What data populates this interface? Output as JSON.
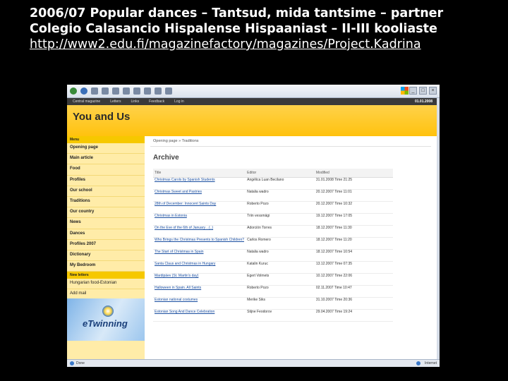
{
  "slide": {
    "title_line1": "2006/07 Popular dances – Tantsud, mida tantsime – partner",
    "title_line2": "Colegio Calasancio Hispalense Hispaaniast – II-III kooliaste",
    "link": "http://www2.edu.fi/magazinefactory/magazines/Project.Kadrina"
  },
  "site": {
    "nav": [
      "Central magazine",
      "Letters",
      "Links",
      "Feedback",
      "Log in"
    ],
    "date": "01.01.2008",
    "brand": "You and Us",
    "breadcrumb": "Opening page » Traditions",
    "heading": "Archive",
    "sidebar_head": "Menu",
    "sidebar_items": [
      "Opening page",
      "Main article",
      "Food",
      "Profiles",
      "Our school",
      "Traditions",
      "Our country",
      "News",
      "Dances",
      "Profiles 2007",
      "Dictionary",
      "My Bedroom"
    ],
    "sidebar_head2": "New letters",
    "sidebar_items2": [
      "Hungarian food-Estonian",
      "Add mail"
    ],
    "etwinning": "eTwinning",
    "columns": [
      "Title",
      "Editor",
      "Modified"
    ],
    "rows": [
      {
        "title": "Christmas Carols by Spanish Students",
        "editor": "Angélica Luan Becilano",
        "modified": "31.01.2008 Time 21:25"
      },
      {
        "title": "Christmas Sweet and Pastries",
        "editor": "Natalia wadro",
        "modified": "20.12.2007 Time 11:01"
      },
      {
        "title": "28th of December: Innocent Saints Day",
        "editor": "Roberto Pozo",
        "modified": "20.12.2007 Time 10:32"
      },
      {
        "title": "Christmas in Estonia",
        "editor": "Triin vessmägi",
        "modified": "19.12.2007 Time 17:05"
      },
      {
        "title": "On the Eve of the 6th of January…(..)",
        "editor": "Adorción Torres",
        "modified": "18.12.2007 Time 11:30"
      },
      {
        "title": "Who Brings the Christmas Presents to Spanish Children?",
        "editor": "Carlos Romero",
        "modified": "18.12.2007 Time 11:20"
      },
      {
        "title": "The Start of Christmas in Spain",
        "editor": "Natalia wadro",
        "modified": "18.12.2007 Time 10:54"
      },
      {
        "title": "Santa Claus and Christmas in Hungary",
        "editor": "Katalin Kuruc",
        "modified": "13.12.2007 Time 07:35"
      },
      {
        "title": "Mardipäev (St. Martin's day)",
        "editor": "Egert Volmets",
        "modified": "10.12.2007 Time 22:06"
      },
      {
        "title": "Halloween in Spain. All Saints",
        "editor": "Roberto Pozo",
        "modified": "02.11.2007 Time 10:47"
      },
      {
        "title": "Estonian national costumes",
        "editor": "Merike Siks",
        "modified": "31.10.2007 Time 20:36"
      },
      {
        "title": "Estonian Song And Dance Celebration",
        "editor": "Stijne Feodorov",
        "modified": "29.04.2007 Time 19:24"
      }
    ],
    "status_left": "Done",
    "status_zone": "Internet"
  }
}
